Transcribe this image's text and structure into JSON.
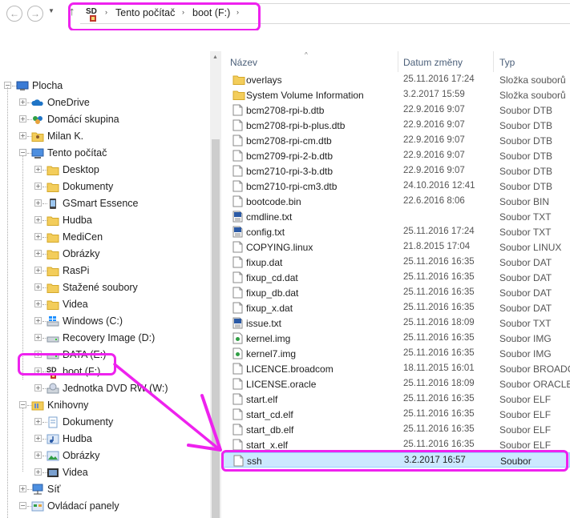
{
  "address": {
    "back_icon": "back-arrow-icon",
    "forward_icon": "forward-arrow-icon",
    "recent_icon": "chevron-down-icon",
    "up_icon": "up-arrow-icon",
    "up_glyph": "↑",
    "back_glyph": "←",
    "fwd_glyph": "→",
    "recent_glyph": "▼",
    "sep": "›",
    "crumbs": [
      "Tento počítač",
      "boot (F:)"
    ]
  },
  "nav": {
    "items": [
      {
        "label": "Plocha",
        "icon": "desktop-icon",
        "expander": "−"
      },
      {
        "label": "OneDrive",
        "icon": "onedrive-icon",
        "expander": "+"
      },
      {
        "label": "Domácí skupina",
        "icon": "homegroup-icon",
        "expander": "+"
      },
      {
        "label": "Milan K.",
        "icon": "user-folder-icon",
        "expander": "+"
      },
      {
        "label": "Tento počítač",
        "icon": "computer-icon",
        "expander": "−"
      },
      {
        "label": "Desktop",
        "icon": "folder-icon",
        "expander": "+"
      },
      {
        "label": "Dokumenty",
        "icon": "folder-icon",
        "expander": "+"
      },
      {
        "label": "GSmart Essence",
        "icon": "phone-icon",
        "expander": "+"
      },
      {
        "label": "Hudba",
        "icon": "folder-icon",
        "expander": "+"
      },
      {
        "label": "MediCen",
        "icon": "folder-icon",
        "expander": "+"
      },
      {
        "label": "Obrázky",
        "icon": "folder-icon",
        "expander": "+"
      },
      {
        "label": "RasPi",
        "icon": "folder-icon",
        "expander": "+"
      },
      {
        "label": "Stažené soubory",
        "icon": "folder-icon",
        "expander": "+"
      },
      {
        "label": "Videa",
        "icon": "folder-icon",
        "expander": "+"
      },
      {
        "label": "Windows (C:)",
        "icon": "windows-drive-icon",
        "expander": "+"
      },
      {
        "label": "Recovery Image (D:)",
        "icon": "drive-icon",
        "expander": "+"
      },
      {
        "label": "DATA (E:)",
        "icon": "drive-icon",
        "expander": "+"
      },
      {
        "label": "boot (F:)",
        "icon": "sd-card-icon",
        "expander": "+"
      },
      {
        "label": "Jednotka DVD RW (W:)",
        "icon": "dvd-drive-icon",
        "expander": "+"
      },
      {
        "label": "Knihovny",
        "icon": "libraries-icon",
        "expander": "−"
      },
      {
        "label": "Dokumenty",
        "icon": "documents-library-icon",
        "expander": "+"
      },
      {
        "label": "Hudba",
        "icon": "music-library-icon",
        "expander": "+"
      },
      {
        "label": "Obrázky",
        "icon": "pictures-library-icon",
        "expander": "+"
      },
      {
        "label": "Videa",
        "icon": "videos-library-icon",
        "expander": "+"
      },
      {
        "label": "Síť",
        "icon": "network-icon",
        "expander": "+"
      },
      {
        "label": "Ovládací panely",
        "icon": "control-panel-icon",
        "expander": "−"
      },
      {
        "label": "Hardware a zvuk",
        "icon": "hardware-sound-icon",
        "expander": "+"
      }
    ],
    "sd_text": "SD"
  },
  "files": {
    "headers": {
      "name": "Název",
      "date": "Datum změny",
      "type": "Typ"
    },
    "sort_caret": "^",
    "rows": [
      {
        "name": "overlays",
        "date": "25.11.2016 17:24",
        "type": "Složka souborů",
        "icon": "folder-icon"
      },
      {
        "name": "System Volume Information",
        "date": "3.2.2017 15:59",
        "type": "Složka souborů",
        "icon": "folder-icon"
      },
      {
        "name": "bcm2708-rpi-b.dtb",
        "date": "22.9.2016 9:07",
        "type": "Soubor DTB",
        "icon": "file-icon"
      },
      {
        "name": "bcm2708-rpi-b-plus.dtb",
        "date": "22.9.2016 9:07",
        "type": "Soubor DTB",
        "icon": "file-icon"
      },
      {
        "name": "bcm2708-rpi-cm.dtb",
        "date": "22.9.2016 9:07",
        "type": "Soubor DTB",
        "icon": "file-icon"
      },
      {
        "name": "bcm2709-rpi-2-b.dtb",
        "date": "22.9.2016 9:07",
        "type": "Soubor DTB",
        "icon": "file-icon"
      },
      {
        "name": "bcm2710-rpi-3-b.dtb",
        "date": "22.9.2016 9:07",
        "type": "Soubor DTB",
        "icon": "file-icon"
      },
      {
        "name": "bcm2710-rpi-cm3.dtb",
        "date": "24.10.2016 12:41",
        "type": "Soubor DTB",
        "icon": "file-icon"
      },
      {
        "name": "bootcode.bin",
        "date": "22.6.2016 8:06",
        "type": "Soubor BIN",
        "icon": "file-icon"
      },
      {
        "name": "cmdline.txt",
        "date": "",
        "type": "Soubor TXT",
        "icon": "text-file-icon"
      },
      {
        "name": "config.txt",
        "date": "25.11.2016 17:24",
        "type": "Soubor TXT",
        "icon": "text-file-icon"
      },
      {
        "name": "COPYING.linux",
        "date": "21.8.2015 17:04",
        "type": "Soubor LINUX",
        "icon": "file-icon"
      },
      {
        "name": "fixup.dat",
        "date": "25.11.2016 16:35",
        "type": "Soubor DAT",
        "icon": "file-icon"
      },
      {
        "name": "fixup_cd.dat",
        "date": "25.11.2016 16:35",
        "type": "Soubor DAT",
        "icon": "file-icon"
      },
      {
        "name": "fixup_db.dat",
        "date": "25.11.2016 16:35",
        "type": "Soubor DAT",
        "icon": "file-icon"
      },
      {
        "name": "fixup_x.dat",
        "date": "25.11.2016 16:35",
        "type": "Soubor DAT",
        "icon": "file-icon"
      },
      {
        "name": "issue.txt",
        "date": "25.11.2016 18:09",
        "type": "Soubor TXT",
        "icon": "text-file-icon"
      },
      {
        "name": "kernel.img",
        "date": "25.11.2016 16:35",
        "type": "Soubor IMG",
        "icon": "image-file-icon"
      },
      {
        "name": "kernel7.img",
        "date": "25.11.2016 16:35",
        "type": "Soubor IMG",
        "icon": "image-file-icon"
      },
      {
        "name": "LICENCE.broadcom",
        "date": "18.11.2015 16:01",
        "type": "Soubor BROADC",
        "icon": "file-icon"
      },
      {
        "name": "LICENSE.oracle",
        "date": "25.11.2016 18:09",
        "type": "Soubor ORACLE",
        "icon": "file-icon"
      },
      {
        "name": "start.elf",
        "date": "25.11.2016 16:35",
        "type": "Soubor ELF",
        "icon": "file-icon"
      },
      {
        "name": "start_cd.elf",
        "date": "25.11.2016 16:35",
        "type": "Soubor ELF",
        "icon": "file-icon"
      },
      {
        "name": "start_db.elf",
        "date": "25.11.2016 16:35",
        "type": "Soubor ELF",
        "icon": "file-icon"
      },
      {
        "name": "start_x.elf",
        "date": "25.11.2016 16:35",
        "type": "Soubor ELF",
        "icon": "file-icon"
      },
      {
        "name": "ssh",
        "date": "3.2.2017 16:57",
        "type": "Soubor",
        "icon": "file-icon",
        "selected": true
      }
    ]
  },
  "colors": {
    "highlight": "#ee22ee",
    "selection": "#cce8ff",
    "header_text": "#4c607a"
  }
}
